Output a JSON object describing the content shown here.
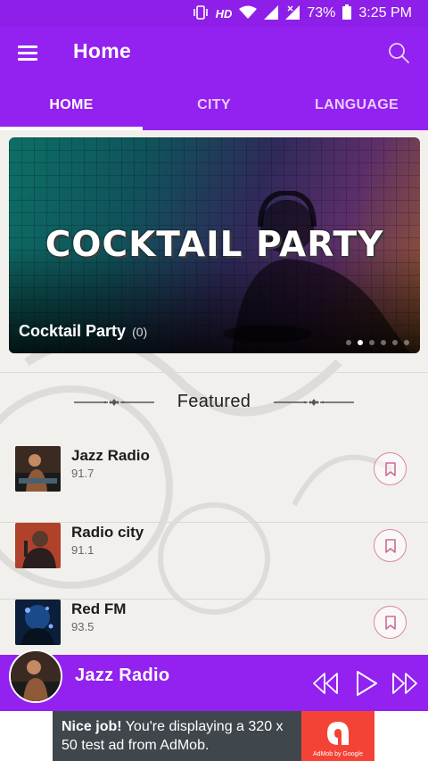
{
  "status_bar": {
    "hd": "HD",
    "battery": "73%",
    "time": "3:25 PM"
  },
  "header": {
    "title": "Home"
  },
  "tabs": [
    {
      "label": "HOME",
      "active": true
    },
    {
      "label": "CITY",
      "active": false
    },
    {
      "label": "LANGUAGE",
      "active": false
    }
  ],
  "banner": {
    "art_text": "COCKTAIL PARTY",
    "caption": "Cocktail Party",
    "count": "(0)",
    "slide_count": 6,
    "active_slide": 2
  },
  "featured": {
    "title": "Featured",
    "stations": [
      {
        "name": "Jazz Radio",
        "freq": "91.7"
      },
      {
        "name": "Radio city",
        "freq": "91.1"
      },
      {
        "name": "Red FM",
        "freq": "93.5"
      }
    ]
  },
  "player": {
    "title": "Jazz Radio"
  },
  "ad": {
    "bold": "Nice job!",
    "text": " You're displaying a 320 x 50 test ad from AdMob.",
    "caption": "AdMob by Google"
  },
  "colors": {
    "primary": "#9321f0",
    "status_bar": "#8e1fe8",
    "bookmark_accent": "#d985a9",
    "ad_red": "#f44336"
  }
}
